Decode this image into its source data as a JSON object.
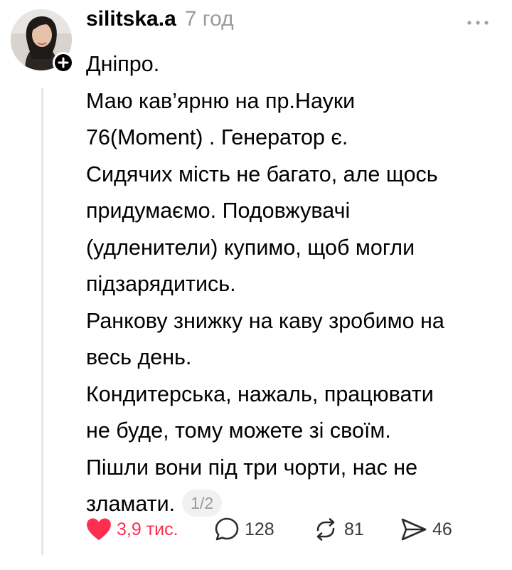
{
  "post": {
    "username": "silitska.a",
    "time": "7 год",
    "more_icon": "more-dots-icon",
    "avatar_icon": "user-avatar",
    "follow_icon": "plus-icon",
    "lines": [
      "Дніпро.",
      "Маю кав’ярню на пр.Науки",
      "76(Moment) . Генератор є.",
      "Сидячих мість не багато, але щось",
      "придумаємо. Подовжувачі",
      "(удленители) купимо, щоб могли",
      "підзарядитись.",
      "Ранкову знижку на каву зробимо на",
      "весь день.",
      "Кондитерська, нажаль, працювати",
      "не буде, тому можете зі своїм.",
      "Пішли вони під три чорти, нас не"
    ],
    "last_line": "зламати.",
    "page_indicator": "1/2"
  },
  "actions": {
    "like": {
      "icon": "heart-icon",
      "count": "3,9 тис.",
      "liked": true,
      "color": "#ff2d4f"
    },
    "reply": {
      "icon": "comment-icon",
      "count": "128"
    },
    "repost": {
      "icon": "repost-icon",
      "count": "81"
    },
    "share": {
      "icon": "send-icon",
      "count": "46"
    }
  }
}
